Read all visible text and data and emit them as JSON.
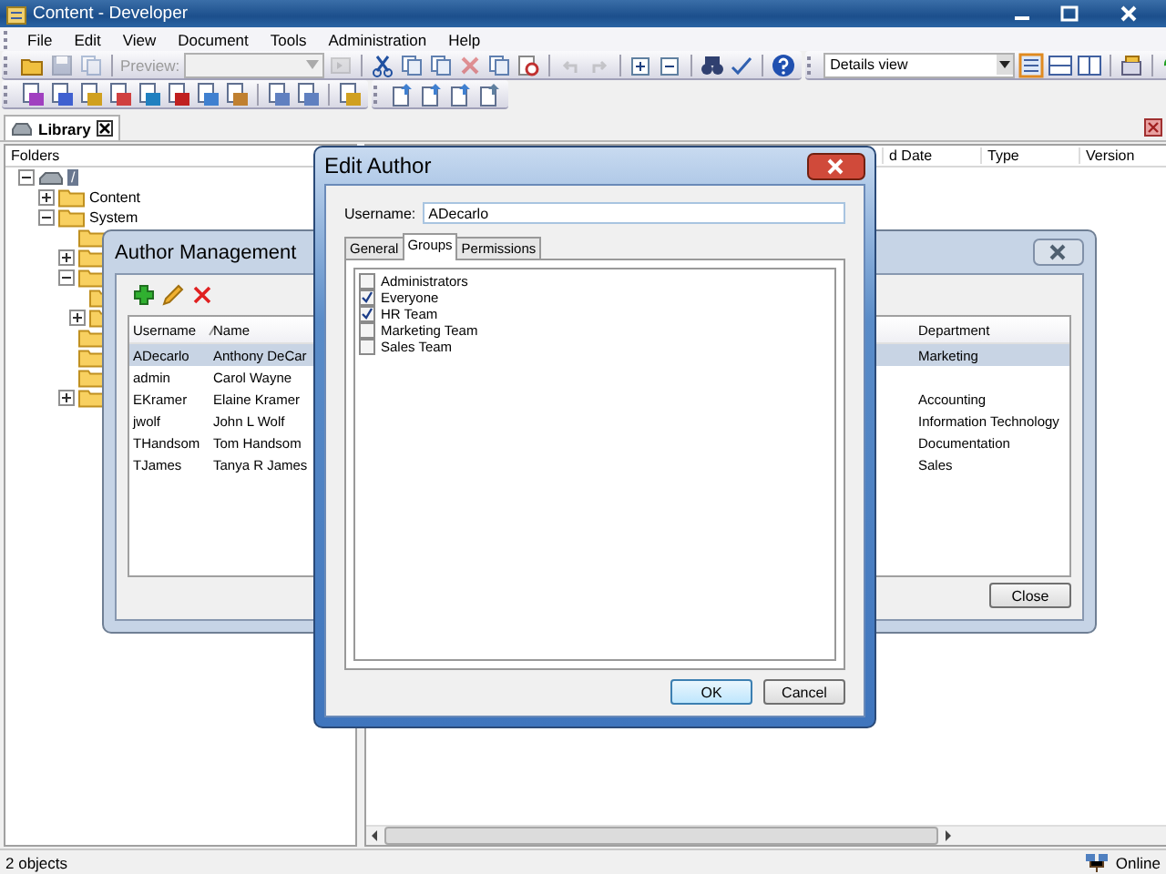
{
  "window": {
    "title": "Content - Developer"
  },
  "menu": [
    "File",
    "Edit",
    "View",
    "Document",
    "Tools",
    "Administration",
    "Help"
  ],
  "toolbar": {
    "preview_label": "Preview:",
    "view_select": "Details view"
  },
  "tabs": [
    {
      "label": "Library",
      "selected": true
    }
  ],
  "folders": {
    "header": "Folders",
    "tree": [
      {
        "kind": "drive",
        "label": "/",
        "selected": true,
        "expanded": true,
        "children": [
          {
            "kind": "folder",
            "label": "Content",
            "selected": false,
            "expanded": false
          },
          {
            "kind": "folder",
            "label": "System",
            "selected": false,
            "expanded": true,
            "children": [
              {
                "kind": "folder"
              },
              {
                "kind": "folder",
                "expanded": false
              },
              {
                "kind": "folder",
                "expanded": true,
                "children": [
                  {
                    "kind": "folder"
                  },
                  {
                    "kind": "folder",
                    "expanded": false
                  }
                ]
              },
              {
                "kind": "folder"
              },
              {
                "kind": "folder"
              },
              {
                "kind": "folder"
              },
              {
                "kind": "folder",
                "expanded": false
              }
            ]
          }
        ]
      }
    ]
  },
  "list_columns": [
    "d Date",
    "Type",
    "Version"
  ],
  "author_management": {
    "title": "Author Management",
    "columns": [
      "Username",
      "Name",
      "Department"
    ],
    "rows": [
      {
        "username": "ADecarlo",
        "name": "Anthony DeCar",
        "department": "Marketing",
        "selected": true
      },
      {
        "username": "admin",
        "name": "Carol Wayne",
        "selected": false
      },
      {
        "username": "EKramer",
        "name": "Elaine Kramer",
        "department": "Accounting",
        "selected": false
      },
      {
        "username": "jwolf",
        "name": "John L Wolf",
        "department": "Information Technology",
        "selected": false
      },
      {
        "username": "THandsom",
        "name": "Tom Handsom",
        "department": "Documentation",
        "selected": false
      },
      {
        "username": "TJames",
        "name": "Tanya R James",
        "department": "Sales",
        "selected": false
      }
    ],
    "close_button": "Close"
  },
  "edit_author": {
    "title": "Edit Author",
    "username_label": "Username:",
    "username": "ADecarlo",
    "tabs": [
      {
        "label": "General",
        "selected": false
      },
      {
        "label": "Groups",
        "selected": true
      },
      {
        "label": "Permissions",
        "selected": false
      }
    ],
    "groups": [
      {
        "label": "Administrators",
        "checked": false
      },
      {
        "label": "Everyone",
        "checked": true
      },
      {
        "label": "HR Team",
        "checked": true
      },
      {
        "label": "Marketing Team",
        "checked": false
      },
      {
        "label": "Sales Team",
        "checked": false
      }
    ],
    "buttons": [
      "OK",
      "Cancel"
    ]
  },
  "status_bar": {
    "text": "2 objects",
    "connection": "Online"
  }
}
